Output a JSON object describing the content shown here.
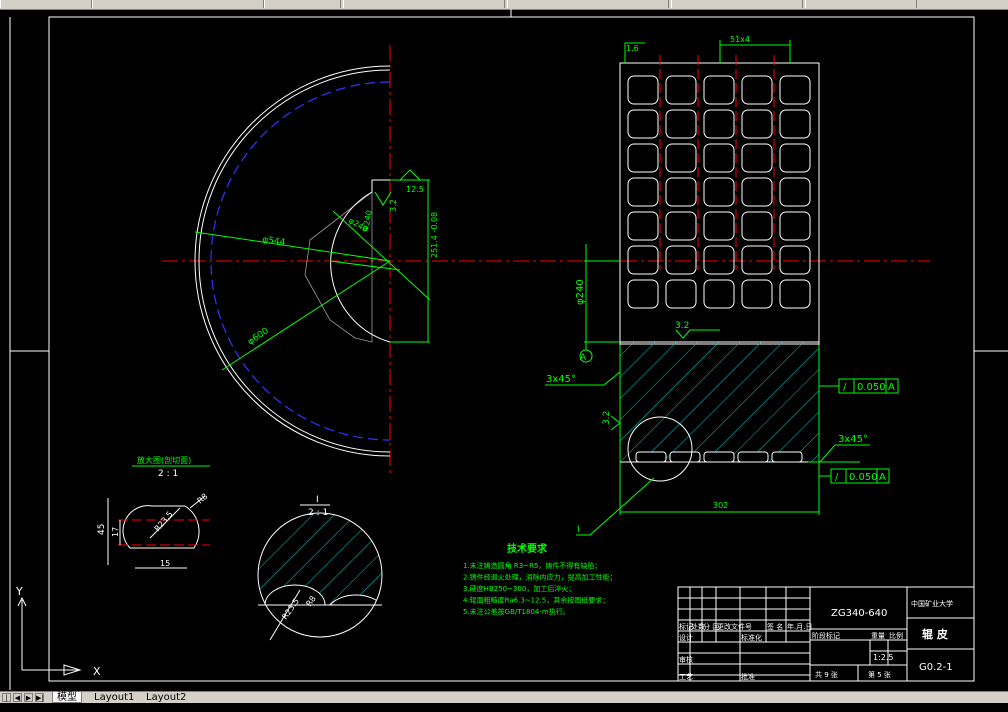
{
  "tabs": [
    {
      "label": "模型",
      "active": true
    },
    {
      "label": "Layout1",
      "active": false
    },
    {
      "label": "Layout2",
      "active": false
    }
  ],
  "drawing": {
    "dims": {
      "d544": "φ544",
      "d600": "φ600",
      "d240a": "φ240",
      "r_ang": "Φ240",
      "h251": "251.4 -0.08",
      "s12_5": "12.5",
      "s3_2a": "3.2",
      "s1_6": "1.6",
      "pitch": "51x4",
      "phi240": "φ240",
      "chamfer1": "3x45°",
      "chamfer2": "3x45°",
      "s3_2b": "3.2",
      "s3_2c": "3.2",
      "width302": "302",
      "tol1": "0.050",
      "tol2": "0.050",
      "datum": "A",
      "datum_ref1": "A",
      "datum_ref2": "A",
      "leader_I": "I",
      "d45": "45",
      "d17": "17",
      "d15": "15",
      "r8": "R8",
      "r25": "R23.5",
      "r25b": "R23.5",
      "r8b": "R8"
    },
    "detail_groove": {
      "title": "放大图(剖切面)",
      "scale": "2 : 1"
    },
    "detail_I": {
      "title": "I",
      "scale": "2 : 1"
    },
    "tech_req": {
      "title": "技术要求",
      "lines": [
        "1.未注铸造圆角 R3~R5，铸件不得有缺陷；",
        "2.铸件经退火处理，消除内应力，提高加工性能；",
        "3.硬度HB250~300，加工后淬火；",
        "4.辊面粗糙度Ra6.3~12.5，其余按图纸要求；",
        "5.未注公差按GB/T1804-m执行。"
      ]
    },
    "title_block": {
      "material": "ZG340-640",
      "school": "中国矿业大学",
      "part_name": "辊 皮",
      "drawing_no": "G0.2-1",
      "scale": "1:2.5",
      "sheet_total": "共 9 张",
      "sheet_no": "第 5 张",
      "h_mark": "标记",
      "h_count": "处数",
      "h_zone": "分 区",
      "h_change": "更改文件号",
      "h_sign": "签 名",
      "h_date": "年.月.日",
      "h_design": "设计",
      "h_std": "标准化",
      "h_review": "审核",
      "h_process": "工艺",
      "h_approve": "批准",
      "h_stage": "阶段标记",
      "h_weight": "重量",
      "h_ratio": "比例"
    }
  },
  "ucs": {
    "y": "Y",
    "x": "X"
  }
}
